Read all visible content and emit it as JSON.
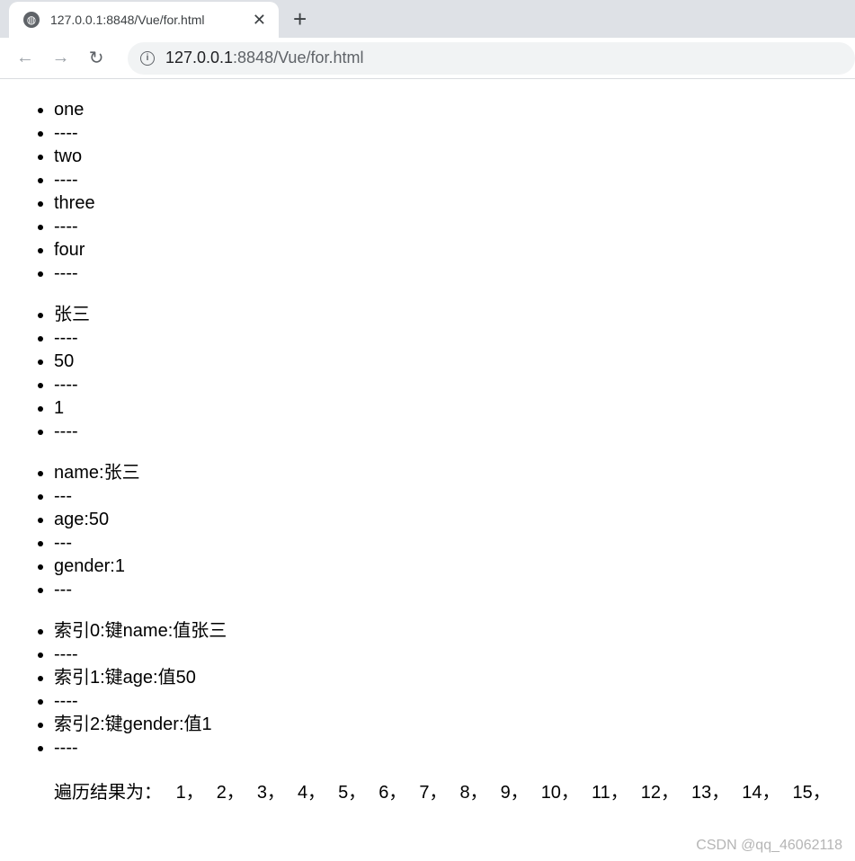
{
  "browser": {
    "tab_title": "127.0.0.1:8848/Vue/for.html",
    "url_host": "127.0.0.1",
    "url_rest": ":8848/Vue/for.html"
  },
  "list1": [
    "one",
    "----",
    "two",
    "----",
    "three",
    "----",
    "four",
    "----"
  ],
  "list2": [
    "张三",
    "----",
    "50",
    "----",
    "1",
    "----"
  ],
  "list3": [
    "name:张三",
    "---",
    "age:50",
    "---",
    "gender:1",
    "---"
  ],
  "list4": [
    "索引0:键name:值张三",
    "----",
    "索引1:键age:值50",
    "----",
    "索引2:键gender:值1",
    "----"
  ],
  "result": {
    "label": "遍历结果为：",
    "values": [
      "1，",
      "2，",
      "3，",
      "4，",
      "5，",
      "6，",
      "7，",
      "8，",
      "9，",
      "10，",
      "11，",
      "12，",
      "13，",
      "14，",
      "15，"
    ]
  },
  "watermark": "CSDN @qq_46062118"
}
